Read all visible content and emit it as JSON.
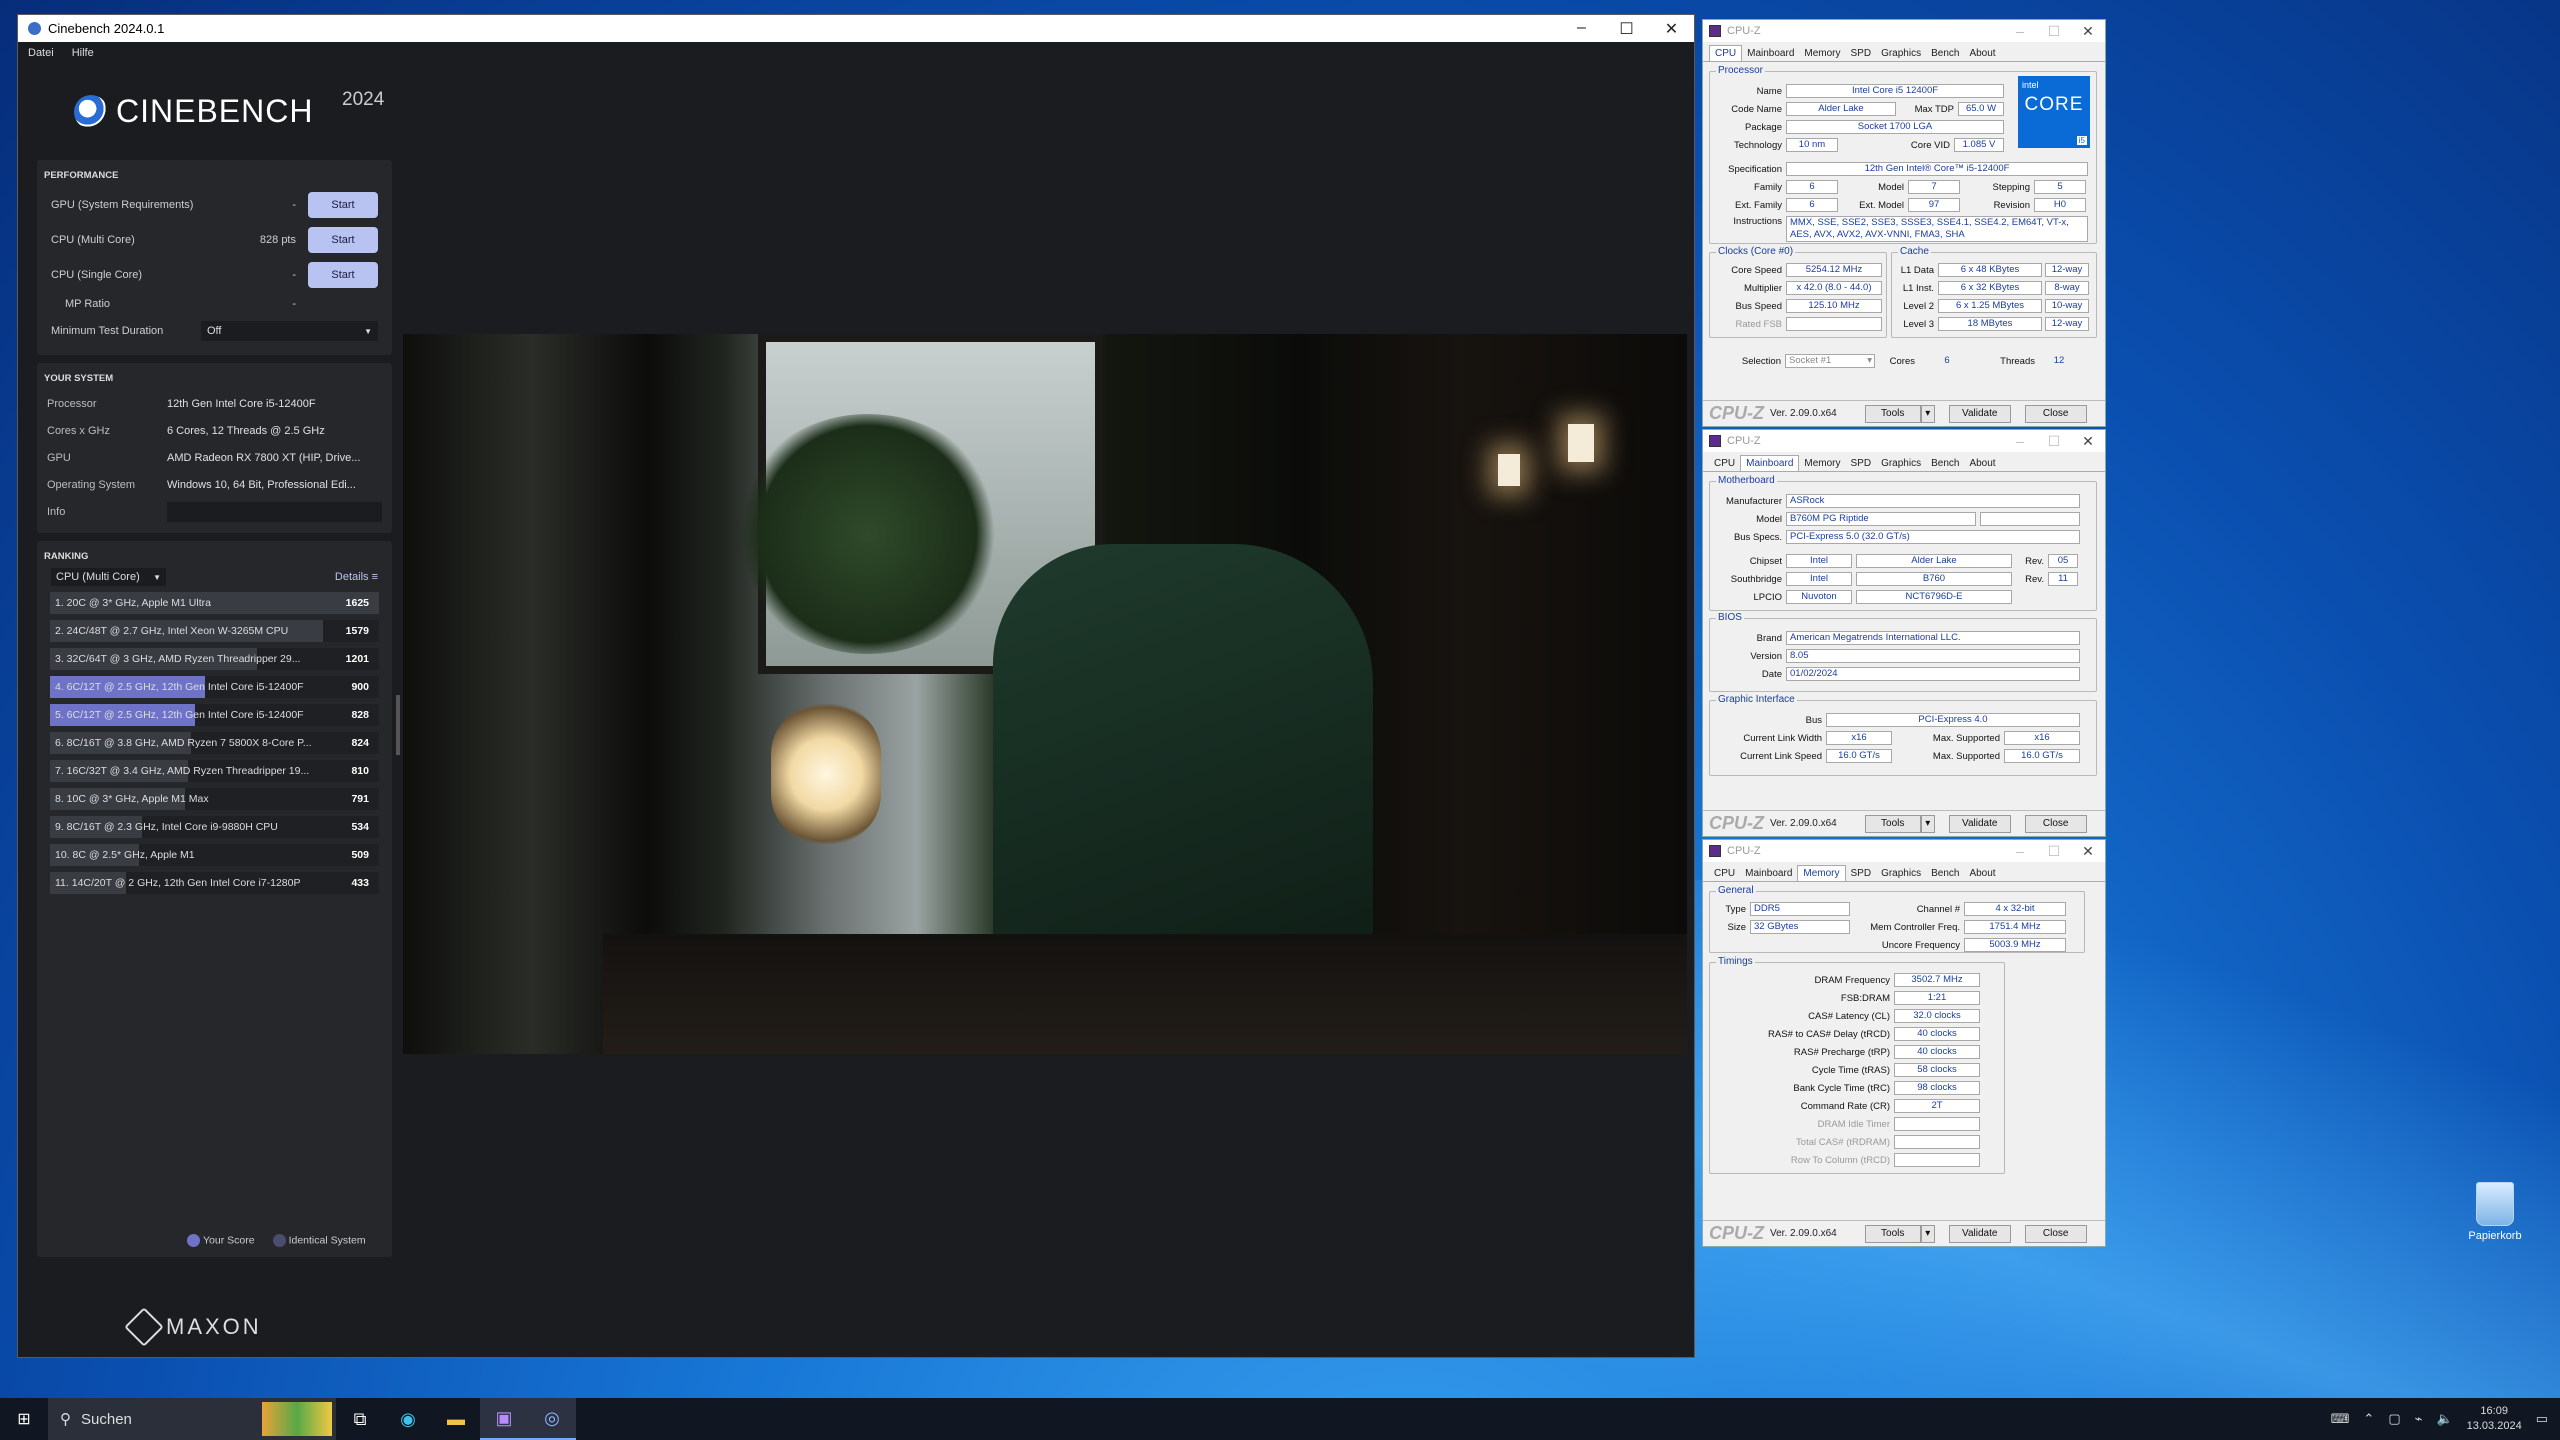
{
  "cinebench": {
    "title": "Cinebench 2024.0.1",
    "menu": [
      "Datei",
      "Hilfe"
    ],
    "logo": "CINEBENCH",
    "year": "2024",
    "performance": {
      "header": "PERFORMANCE",
      "rows": [
        {
          "label": "GPU (System Requirements)",
          "value": "-",
          "button": "Start"
        },
        {
          "label": "CPU (Multi Core)",
          "value": "828 pts",
          "button": "Start"
        },
        {
          "label": "CPU (Single Core)",
          "value": "-",
          "button": "Start"
        }
      ],
      "mp_label": "MP Ratio",
      "mp_value": "-",
      "min_duration_label": "Minimum Test Duration",
      "min_duration_value": "Off"
    },
    "system": {
      "header": "YOUR SYSTEM",
      "rows": [
        {
          "k": "Processor",
          "v": "12th Gen Intel Core i5-12400F"
        },
        {
          "k": "Cores x GHz",
          "v": "6 Cores, 12 Threads @ 2.5 GHz"
        },
        {
          "k": "GPU",
          "v": "AMD Radeon RX 7800 XT (HIP, Drive..."
        },
        {
          "k": "Operating System",
          "v": "Windows 10, 64 Bit, Professional Edi..."
        }
      ],
      "info_label": "Info"
    },
    "ranking": {
      "header": "RANKING",
      "selector": "CPU (Multi Core)",
      "details": "Details",
      "items": [
        {
          "text": "1. 20C @ 3* GHz, Apple M1 Ultra",
          "score": "1625",
          "pct": 1.0,
          "hl": false
        },
        {
          "text": "2. 24C/48T @ 2.7 GHz, Intel Xeon W-3265M CPU",
          "score": "1579",
          "pct": 0.83,
          "hl": false
        },
        {
          "text": "3. 32C/64T @ 3 GHz, AMD Ryzen Threadripper 29...",
          "score": "1201",
          "pct": 0.63,
          "hl": false
        },
        {
          "text": "4. 6C/12T @ 2.5 GHz, 12th Gen Intel Core i5-12400F",
          "score": "900",
          "pct": 0.47,
          "hl": true
        },
        {
          "text": "5. 6C/12T @ 2.5 GHz, 12th Gen Intel Core i5-12400F",
          "score": "828",
          "pct": 0.44,
          "hl": true
        },
        {
          "text": "6. 8C/16T @ 3.8 GHz, AMD Ryzen 7 5800X 8-Core P...",
          "score": "824",
          "pct": 0.43,
          "hl": false
        },
        {
          "text": "7. 16C/32T @ 3.4 GHz, AMD Ryzen Threadripper 19...",
          "score": "810",
          "pct": 0.42,
          "hl": false
        },
        {
          "text": "8. 10C @ 3* GHz, Apple M1 Max",
          "score": "791",
          "pct": 0.41,
          "hl": false
        },
        {
          "text": "9. 8C/16T @ 2.3 GHz, Intel Core i9-9880H CPU",
          "score": "534",
          "pct": 0.28,
          "hl": false
        },
        {
          "text": "10. 8C @ 2.5* GHz, Apple M1",
          "score": "509",
          "pct": 0.27,
          "hl": false
        },
        {
          "text": "11. 14C/20T @ 2 GHz, 12th Gen Intel Core i7-1280P",
          "score": "433",
          "pct": 0.23,
          "hl": false
        }
      ],
      "legend": [
        {
          "label": "Your Score",
          "color": "#6e73c7"
        },
        {
          "label": "Identical System",
          "color": "#4a4d6e"
        }
      ]
    },
    "footer_logo": "MAXON"
  },
  "cpuz_common": {
    "title": "CPU-Z",
    "tabs": [
      "CPU",
      "Mainboard",
      "Memory",
      "SPD",
      "Graphics",
      "Bench",
      "About"
    ],
    "logo": "CPU-Z",
    "version": "Ver. 2.09.0.x64",
    "tools": "Tools",
    "validate": "Validate",
    "close": "Close"
  },
  "cpuz_cpu": {
    "processor_label": "Processor",
    "name_k": "Name",
    "name": "Intel Core i5 12400F",
    "codename_k": "Code Name",
    "codename": "Alder Lake",
    "maxtdp_k": "Max TDP",
    "maxtdp": "65.0 W",
    "package_k": "Package",
    "package": "Socket 1700 LGA",
    "tech_k": "Technology",
    "tech": "10 nm",
    "vid_k": "Core VID",
    "vid": "1.085 V",
    "spec_k": "Specification",
    "spec": "12th Gen Intel® Core™ i5-12400F",
    "family_k": "Family",
    "family": "6",
    "model_k": "Model",
    "model": "7",
    "stepping_k": "Stepping",
    "stepping": "5",
    "extfamily_k": "Ext. Family",
    "extfamily": "6",
    "extmodel_k": "Ext. Model",
    "extmodel": "97",
    "revision_k": "Revision",
    "revision": "H0",
    "instr_k": "Instructions",
    "instr": "MMX, SSE, SSE2, SSE3, SSSE3, SSE4.1, SSE4.2, EM64T, VT-x, AES, AVX, AVX2, AVX-VNNI, FMA3, SHA",
    "clocks_label": "Clocks (Core #0)",
    "corespeed_k": "Core Speed",
    "corespeed": "5254.12 MHz",
    "mult_k": "Multiplier",
    "mult": "x 42.0 (8.0 - 44.0)",
    "bus_k": "Bus Speed",
    "bus": "125.10 MHz",
    "fsb_k": "Rated FSB",
    "cache_label": "Cache",
    "l1d_k": "L1 Data",
    "l1d": "6 x 48 KBytes",
    "l1d_w": "12-way",
    "l1i_k": "L1 Inst.",
    "l1i": "6 x 32 KBytes",
    "l1i_w": "8-way",
    "l2_k": "Level 2",
    "l2": "6 x 1.25 MBytes",
    "l2_w": "10-way",
    "l3_k": "Level 3",
    "l3": "18 MBytes",
    "l3_w": "12-way",
    "sel_k": "Selection",
    "sel": "Socket #1",
    "cores_k": "Cores",
    "cores": "6",
    "threads_k": "Threads",
    "threads": "12",
    "intel_a": "intel",
    "intel_b": "CORE",
    "intel_c": "i5"
  },
  "cpuz_mb": {
    "mb_label": "Motherboard",
    "manu_k": "Manufacturer",
    "manu": "ASRock",
    "model_k": "Model",
    "model": "B760M PG Riptide",
    "busspec_k": "Bus Specs.",
    "busspec": "PCI-Express 5.0 (32.0 GT/s)",
    "chipset_k": "Chipset",
    "chipset_a": "Intel",
    "chipset_b": "Alder Lake",
    "rev_k": "Rev.",
    "chipset_rev": "05",
    "south_k": "Southbridge",
    "south_a": "Intel",
    "south_b": "B760",
    "south_rev": "11",
    "lpcio_k": "LPCIO",
    "lpcio_a": "Nuvoton",
    "lpcio_b": "NCT6796D-E",
    "bios_label": "BIOS",
    "brand_k": "Brand",
    "brand": "American Megatrends International LLC.",
    "ver_k": "Version",
    "ver": "8.05",
    "date_k": "Date",
    "date": "01/02/2024",
    "gi_label": "Graphic Interface",
    "gbus_k": "Bus",
    "gbus": "PCI-Express 4.0",
    "clw_k": "Current Link Width",
    "clw": "x16",
    "msw_k": "Max. Supported",
    "msw": "x16",
    "cls_k": "Current Link Speed",
    "cls": "16.0 GT/s",
    "mss_k": "Max. Supported",
    "mss": "16.0 GT/s"
  },
  "cpuz_mem": {
    "general_label": "General",
    "type_k": "Type",
    "type": "DDR5",
    "size_k": "Size",
    "size": "32 GBytes",
    "chan_k": "Channel #",
    "chan": "4 x 32-bit",
    "mcf_k": "Mem Controller Freq.",
    "mcf": "1751.4 MHz",
    "unc_k": "Uncore Frequency",
    "unc": "5003.9 MHz",
    "timings_label": "Timings",
    "rows": [
      {
        "k": "DRAM Frequency",
        "v": "3502.7 MHz",
        "dim": false
      },
      {
        "k": "FSB:DRAM",
        "v": "1:21",
        "dim": false
      },
      {
        "k": "CAS# Latency (CL)",
        "v": "32.0 clocks",
        "dim": false
      },
      {
        "k": "RAS# to CAS# Delay (tRCD)",
        "v": "40 clocks",
        "dim": false
      },
      {
        "k": "RAS# Precharge (tRP)",
        "v": "40 clocks",
        "dim": false
      },
      {
        "k": "Cycle Time (tRAS)",
        "v": "58 clocks",
        "dim": false
      },
      {
        "k": "Bank Cycle Time (tRC)",
        "v": "98 clocks",
        "dim": false
      },
      {
        "k": "Command Rate (CR)",
        "v": "2T",
        "dim": false
      },
      {
        "k": "DRAM Idle Timer",
        "v": "",
        "dim": true
      },
      {
        "k": "Total CAS# (tRDRAM)",
        "v": "",
        "dim": true
      },
      {
        "k": "Row To Column (tRCD)",
        "v": "",
        "dim": true
      }
    ]
  },
  "taskbar": {
    "search": "Suchen",
    "time": "16:09",
    "date": "13.03.2024"
  },
  "desktop": {
    "recycle": "Papierkorb"
  }
}
